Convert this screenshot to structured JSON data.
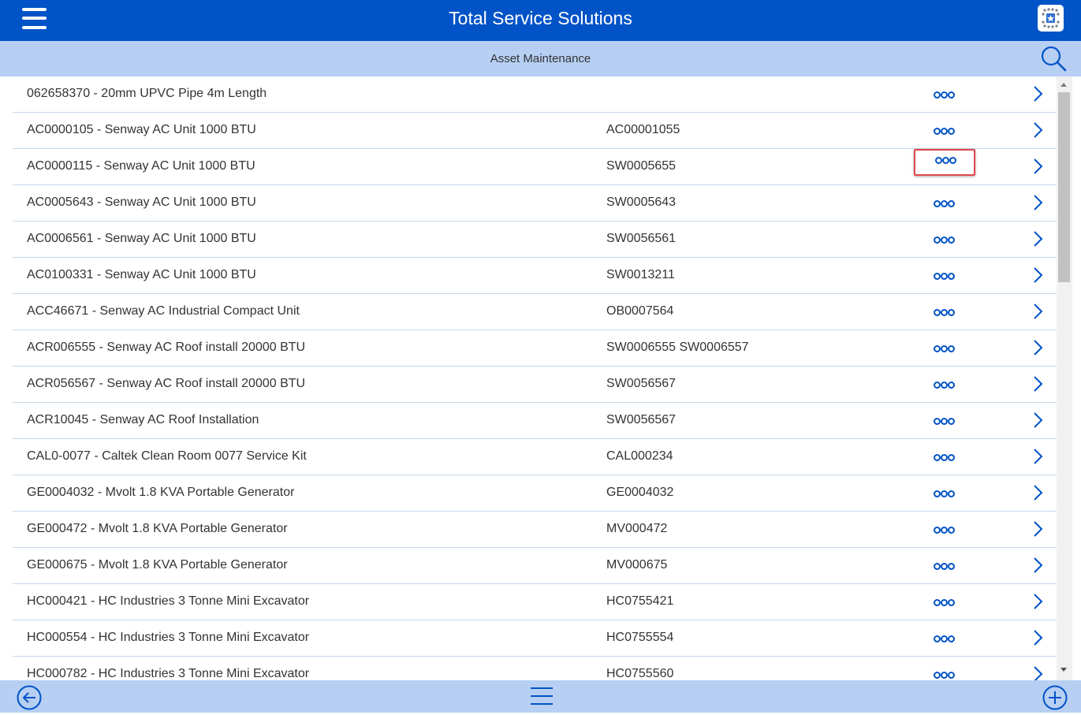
{
  "header": {
    "title": "Total Service Solutions",
    "menu_icon": "hamburger-menu-icon",
    "app_icon": "app-logo-icon",
    "background": "#0153c7"
  },
  "subheader": {
    "title": "Asset Maintenance",
    "search_icon": "search-icon",
    "background": "#b7cff3"
  },
  "assets": [
    {
      "name": "062658370 - 20mm UPVC Pipe 4m Length",
      "code": ""
    },
    {
      "name": "AC0000105 - Senway AC Unit 1000 BTU",
      "code": "AC00001055"
    },
    {
      "name": "AC0000115 - Senway AC Unit 1000 BTU",
      "code": "SW0005655"
    },
    {
      "name": "AC0005643 - Senway AC Unit 1000 BTU",
      "code": "SW0005643"
    },
    {
      "name": "AC0006561 - Senway AC Unit 1000 BTU",
      "code": "SW0056561"
    },
    {
      "name": "AC0100331 - Senway AC Unit 1000 BTU",
      "code": "SW0013211"
    },
    {
      "name": "ACC46671 - Senway AC Industrial Compact Unit",
      "code": "OB0007564"
    },
    {
      "name": "ACR006555 - Senway AC Roof install 20000 BTU",
      "code": "SW0006555 SW0006557"
    },
    {
      "name": "ACR056567 - Senway AC Roof install 20000 BTU",
      "code": "SW0056567"
    },
    {
      "name": "ACR10045 - Senway AC Roof Installation",
      "code": "SW0056567"
    },
    {
      "name": "CAL0-0077 - Caltek Clean Room 0077 Service Kit",
      "code": "CAL000234"
    },
    {
      "name": "GE0004032 - Mvolt 1.8 KVA Portable Generator",
      "code": "GE0004032"
    },
    {
      "name": "GE000472 - Mvolt 1.8 KVA Portable Generator",
      "code": "MV000472"
    },
    {
      "name": "GE000675 - Mvolt 1.8 KVA Portable Generator",
      "code": "MV000675"
    },
    {
      "name": "HC000421 - HC Industries 3 Tonne Mini Excavator",
      "code": "HC0755421"
    },
    {
      "name": "HC000554 - HC Industries 3 Tonne Mini Excavator",
      "code": "HC0755554"
    },
    {
      "name": "HC000782 - HC Industries 3 Tonne Mini Excavator",
      "code": "HC0755560"
    }
  ],
  "row_icons": {
    "more": "more-options-icon",
    "open": "chevron-right-icon"
  },
  "highlighted_row": 2,
  "footer": {
    "back_icon": "back-arrow-icon",
    "menu_icon": "list-menu-icon",
    "add_icon": "add-icon",
    "background": "#b7cff3"
  },
  "colors": {
    "accent": "#0153c7",
    "highlight_border": "#e0474c",
    "divider": "#c6d7ec"
  }
}
